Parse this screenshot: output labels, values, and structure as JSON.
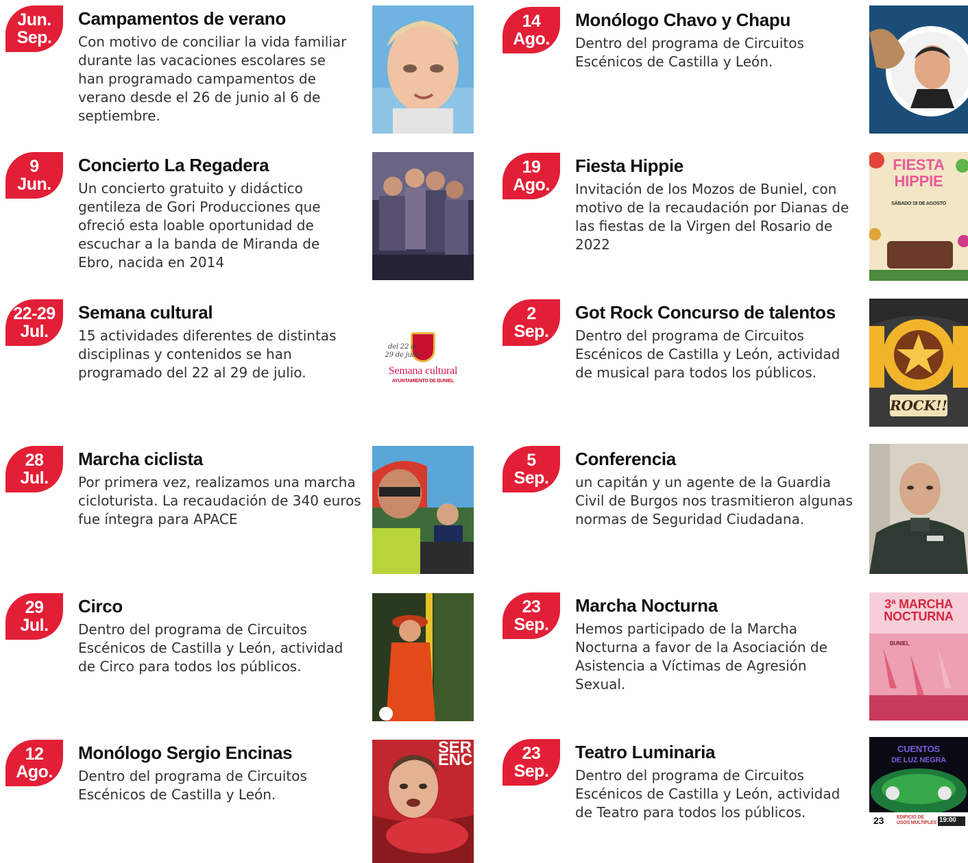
{
  "events": [
    {
      "badge": [
        "Jun.",
        "Sep."
      ],
      "title": "Campamentos  de verano",
      "description": "Con motivo de conciliar la vida familiar durante las vacaciones escolares se han programado campamentos de verano desde el 26 de junio al 6 de septiembre.",
      "image": "child-photo"
    },
    {
      "badge": [
        "9",
        "Jun."
      ],
      "title": "Concierto La Regadera",
      "description": "Un concierto gratuito y didáctico gentileza de Gori Producciones que ofreció esta loable oportunidad de escuchar a la banda de Miranda de Ebro, nacida en 2014",
      "image": "band-photo"
    },
    {
      "badge": [
        "22-29",
        "Jul."
      ],
      "title": "Semana cultural",
      "description": "15 actividades diferentes de distintas disciplinas y contenidos se han programado del 22 al 29 de julio.",
      "image": "semana-cultural-logo",
      "image_text": [
        "del 22 al",
        "29 de julio",
        "Semana cultural",
        "AYUNTAMIENTO DE BUNIEL"
      ]
    },
    {
      "badge": [
        "28",
        "Jul."
      ],
      "title": "Marcha ciclista",
      "description": "Por primera vez, realizamos una marcha cicloturista. La recaudación de 340 euros fue íntegra para APACE",
      "image": "cyclists-photo"
    },
    {
      "badge": [
        "29",
        "Jul."
      ],
      "title": "Circo",
      "description": "Dentro del programa de Circuitos Escénicos de Castilla y León, actividad de Circo para todos los públicos.",
      "image": "circus-performer-photo"
    },
    {
      "badge": [
        "12",
        "Ago."
      ],
      "title": "Monólogo Sergio Encinas",
      "description": "Dentro del programa de Circuitos Escénicos de Castilla y León.",
      "image": "comedian-poster",
      "image_text": [
        "SER",
        "ENC"
      ]
    },
    {
      "badge": [
        "14",
        "Ago."
      ],
      "title": "Monólogo Chavo y Chapu",
      "description": "Dentro del programa de Circuitos Escénicos de Castilla y León.",
      "image": "comedian-circle-photo"
    },
    {
      "badge": [
        "19",
        "Ago."
      ],
      "title": "Fiesta Hippie",
      "description": "Invitación de los Mozos de Buniel, con motivo de la recaudación por Dianas de las fiestas de la Virgen del Rosario de 2022",
      "image": "fiesta-hippie-poster",
      "image_text": [
        "FIESTA",
        "HIPPIE",
        "SÁBADO 19 DE AGOSTO"
      ]
    },
    {
      "badge": [
        "2",
        "Sep."
      ],
      "title": "Got Rock Concurso de talentos",
      "description": "Dentro del programa de Circuitos Escénicos de Castilla y León, actividad de musical para todos los públicos.",
      "image": "got-rock-poster",
      "image_text": [
        "ROCK!!"
      ]
    },
    {
      "badge": [
        "5",
        "Sep."
      ],
      "title": "Conferencia",
      "description": "un capitán y un agente de la Guardia Civil de Burgos nos trasmitieron algunas normas de Seguridad Ciudadana.",
      "image": "guardia-civil-photo"
    },
    {
      "badge": [
        "23",
        "Sep."
      ],
      "title": "Marcha Nocturna",
      "description": "Hemos participado de la Marcha Nocturna a favor de la Asociación de Asistencia a Víctimas de Agresión Sexual.",
      "image": "marcha-nocturna-poster",
      "image_text": [
        "3ª MARCHA",
        "NOCTURNA",
        "BUNIEL"
      ]
    },
    {
      "badge": [
        "23",
        "Sep."
      ],
      "title": "Teatro Luminaria",
      "description": "Dentro del programa de Circuitos Escénicos de Castilla y León, actividad de Teatro para todos los públicos.",
      "image": "teatro-poster",
      "image_text": [
        "CUENTOS",
        "DE LUZ NEGRA",
        "23",
        "EDIFICIO DE",
        "USOS MÚLTIPLES",
        "19:00"
      ]
    }
  ],
  "colors": {
    "accent": "#e21f37",
    "title": "#111111",
    "text": "#333333"
  }
}
